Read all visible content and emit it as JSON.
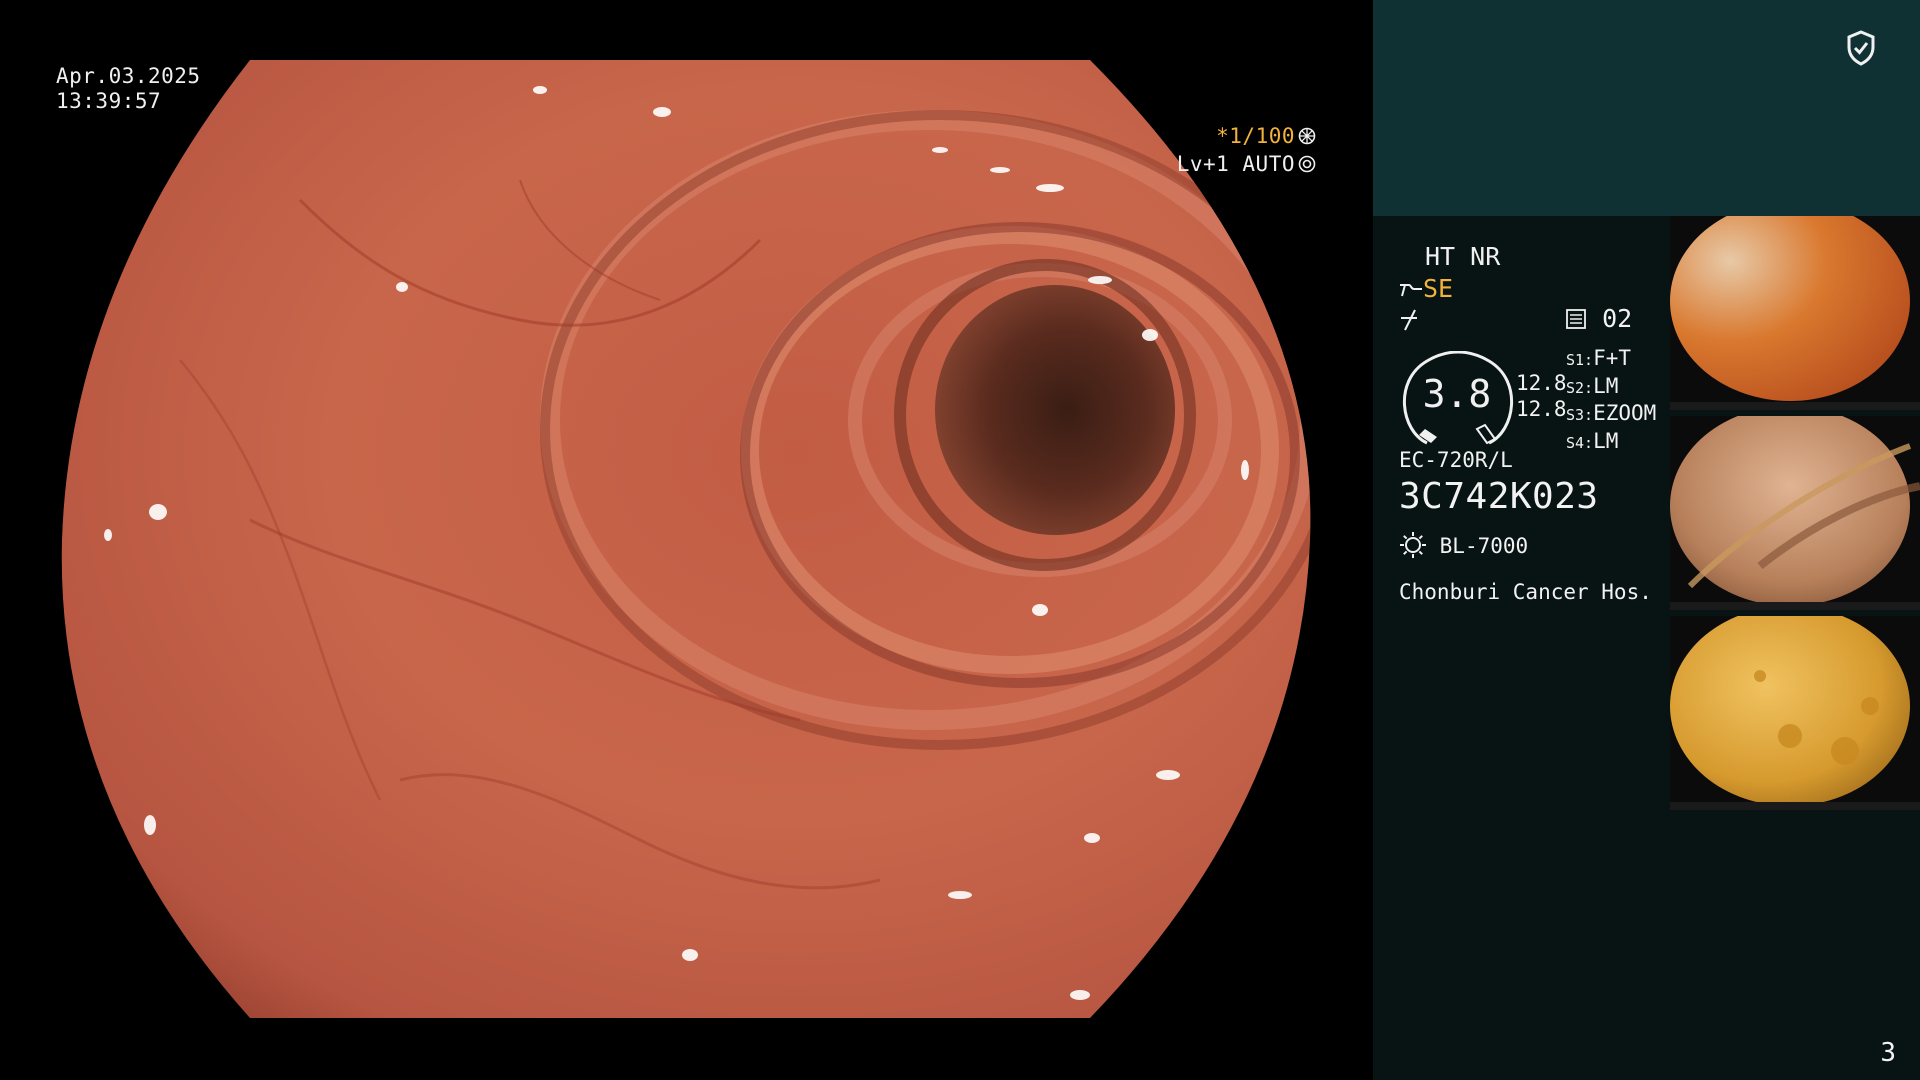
{
  "overlay": {
    "date": "Apr.03.2025",
    "time": "13:39:57",
    "shutter": "*1/100",
    "shutter_icon": "aperture-icon",
    "level": "Lv+1 AUTO",
    "level_icon": "iris-icon"
  },
  "panel": {
    "badge_icon": "shield-check-icon",
    "mode_line": "HT NR",
    "se_label": "SE",
    "structure_icon": "structure-enhance-icon",
    "slash_icon": "color-enhance-icon",
    "preset_icon": "preset-icon",
    "preset_value": "02",
    "gauge_value": "3.8",
    "gauge_side_top": "12.8",
    "gauge_side_bottom": "12.8",
    "scope_list": [
      {
        "key": "S1:",
        "value": "F+T"
      },
      {
        "key": "S2:",
        "value": "LM"
      },
      {
        "key": "S3:",
        "value": "EZOOM"
      },
      {
        "key": "S4:",
        "value": "LM"
      }
    ],
    "scope_model": "EC-720R/L",
    "serial": "3C742K023",
    "light_icon": "light-source-icon",
    "light_source": "BL-7000",
    "hospital": "Chonburi Cancer Hos.",
    "page_number": "3"
  },
  "thumbnails": [
    {
      "name": "thumbnail-1",
      "tone": "#d9782e"
    },
    {
      "name": "thumbnail-2",
      "tone": "#b7805b"
    },
    {
      "name": "thumbnail-3",
      "tone": "#d69a2e"
    }
  ],
  "colors": {
    "accent_orange": "#f3b23a",
    "panel_header": "#0f3134",
    "panel_body": "#081313"
  }
}
